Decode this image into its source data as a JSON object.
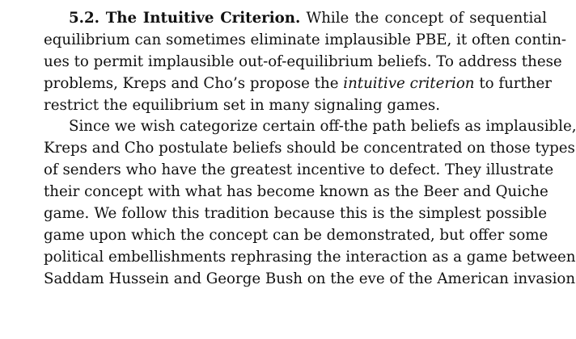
{
  "section": {
    "heading": "5.2. The Intuitive Criterion.",
    "paragraph1": {
      "line1_rest": "While the concept of sequential",
      "line2": "equilibrium can sometimes eliminate implausible PBE, it often contin-",
      "line3": "ues to permit implausible out-of-equilibrium beliefs.  To address these",
      "line4_a": "problems, Kreps and Cho’s propose the",
      "line4_em": "intuitive criterion",
      "line4_b": "to further",
      "line5": "restrict the equilibrium set in many signaling games."
    },
    "paragraph2": {
      "line1": "Since we wish categorize certain off-the path beliefs as implausible,",
      "line2": "Kreps and Cho postulate beliefs should be concentrated on those types",
      "line3": "of senders who have the greatest incentive to defect.  They illustrate",
      "line4": "their concept with what has become known as the Beer and Quiche",
      "line5": "game.  We follow this tradition because this is the simplest possible",
      "line6": "game upon which the concept can be demonstrated, but offer some",
      "line7": "political embellishments rephrasing the interaction as a game between",
      "line8": "Saddam Hussein and George Bush on the eve of the American invasion"
    }
  }
}
